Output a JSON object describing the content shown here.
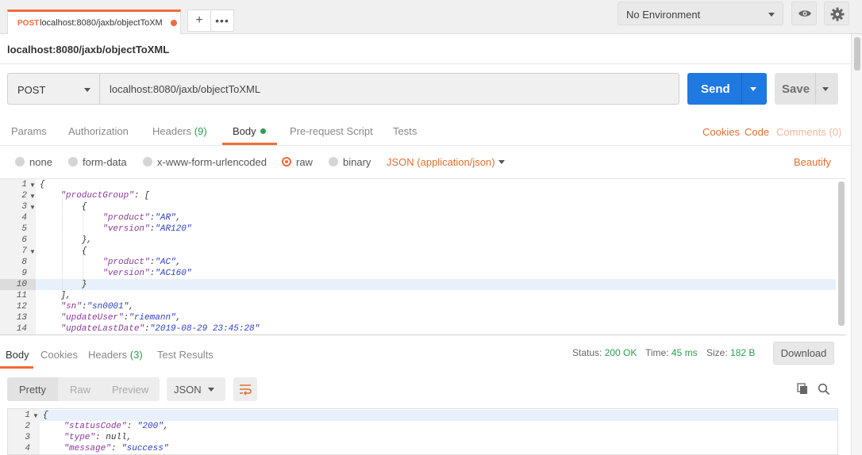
{
  "tabs": [
    {
      "method": "POST",
      "url": "localhost:8080/jaxb/objectToXM"
    }
  ],
  "environment": {
    "selected": "No Environment"
  },
  "request": {
    "title": "localhost:8080/jaxb/objectToXML",
    "method": "POST",
    "url": "localhost:8080/jaxb/objectToXML",
    "send_label": "Send",
    "save_label": "Save"
  },
  "request_tabs": {
    "params": "Params",
    "authorization": "Authorization",
    "headers": "Headers",
    "headers_count": "(9)",
    "body": "Body",
    "prerequest": "Pre-request Script",
    "tests": "Tests"
  },
  "request_links": {
    "cookies": "Cookies",
    "code": "Code",
    "comments": "Comments (0)"
  },
  "body_types": {
    "none": "none",
    "form_data": "form-data",
    "urlencoded": "x-www-form-urlencoded",
    "raw": "raw",
    "binary": "binary",
    "content_type": "JSON (application/json)",
    "beautify": "Beautify",
    "selected": "raw"
  },
  "request_body": {
    "line_numbers": [
      "1",
      "2",
      "3",
      "4",
      "5",
      "6",
      "7",
      "8",
      "9",
      "10",
      "11",
      "12",
      "13",
      "14"
    ],
    "l1": "{",
    "l2k": "\"productGroup\"",
    "l2r": ": [",
    "l3": "{",
    "l4k": "\"product\"",
    "l4s": "\"AR\"",
    "l5k": "\"version\"",
    "l5s": "\"AR120\"",
    "l6": "},",
    "l7": "{",
    "l8k": "\"product\"",
    "l8s": "\"AC\"",
    "l9k": "\"version\"",
    "l9s": "\"AC160\"",
    "l10": "}",
    "l11": "],",
    "l12k": "\"sn\"",
    "l12s": "\"sn0001\"",
    "l13k": "\"updateUser\"",
    "l13s": "\"riemann\"",
    "l14k": "\"updateLastDate\"",
    "l14s": "\"2019-08-29 23:45:28\""
  },
  "response_tabs": {
    "body": "Body",
    "cookies": "Cookies",
    "headers": "Headers",
    "headers_count": "(3)",
    "test_results": "Test Results"
  },
  "response_status": {
    "status_label": "Status:",
    "status_value": "200 OK",
    "time_label": "Time:",
    "time_value": "45 ms",
    "size_label": "Size:",
    "size_value": "182 B",
    "download_label": "Download"
  },
  "response_format": {
    "pretty": "Pretty",
    "raw": "Raw",
    "preview": "Preview",
    "language": "JSON"
  },
  "response_body": {
    "line_numbers": [
      "1",
      "2",
      "3",
      "4"
    ],
    "l1": "{",
    "l2k": "\"statusCode\"",
    "l2s": "\"200\"",
    "l3k": "\"type\"",
    "l3v": "null",
    "l4k": "\"message\"",
    "l4s": "\"success\""
  },
  "colors": {
    "accent": "#f26b3a",
    "send": "#1e79e0",
    "ok": "#2e9e4f"
  }
}
